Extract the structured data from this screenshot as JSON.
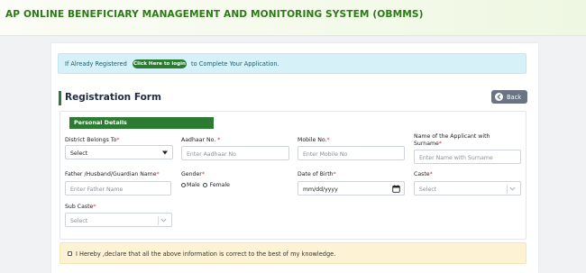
{
  "header": {
    "title": "AP ONLINE BENEFICIARY MANAGEMENT AND MONITORING SYSTEM (OBMMS)"
  },
  "info": {
    "prefix": "If Already Registered",
    "login_button": "Click Here to login",
    "suffix": "to Complete Your Application."
  },
  "form": {
    "title": "Registration Form",
    "back_label": "Back",
    "section_label": "Personal Details"
  },
  "fields": {
    "district": {
      "label": "District Belongs To",
      "value": "Select"
    },
    "aadhaar": {
      "label": "Aadhaar No.",
      "placeholder": "Enter Aadhaar No"
    },
    "mobile": {
      "label": "Mobile No.",
      "placeholder": "Enter Mobile No"
    },
    "applicant_name": {
      "label": "Name of the Applicant with Surname",
      "placeholder": "Enter Name with Surname"
    },
    "father_name": {
      "label": "Father /Husband/Guardian Name",
      "placeholder": "Enter Father Name"
    },
    "gender": {
      "label": "Gender",
      "options": [
        "Male",
        "Female"
      ]
    },
    "dob": {
      "label": "Date of Birth",
      "placeholder": "mm/dd/yyyy"
    },
    "caste": {
      "label": "Caste",
      "placeholder": "Select"
    },
    "sub_caste": {
      "label": "Sub Caste",
      "placeholder": "Select"
    }
  },
  "required_marker": "*",
  "declaration": "I Hereby ,declare that all the above information is correct to the best of my knowledge.",
  "colors": {
    "brand_green": "#2d7a33",
    "header_title": "#2b7a16",
    "info_bg": "#d7f1f8",
    "declaration_bg": "#fdf3d4",
    "back_button": "#6b7482"
  }
}
